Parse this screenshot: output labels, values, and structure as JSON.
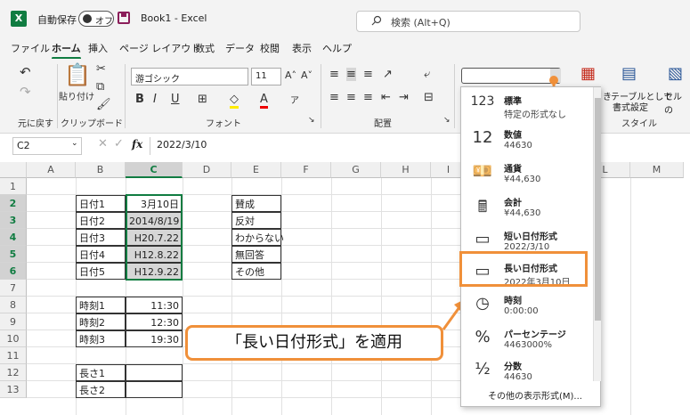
{
  "titlebar": {
    "app_logo": "X",
    "autosave_label": "自動保存",
    "autosave_state": "オフ",
    "book_title": "Book1 - Excel",
    "search_placeholder": "検索 (Alt+Q)"
  },
  "menu": {
    "tabs": [
      "ファイル",
      "ホーム",
      "挿入",
      "ページ レイアウト",
      "数式",
      "データ",
      "校閲",
      "表示",
      "ヘルプ"
    ],
    "active": "ホーム"
  },
  "ribbon": {
    "undo_group": "元に戻す",
    "clipboard_group": "クリップボード",
    "paste_label": "貼り付け",
    "font_group": "フォント",
    "font_name": "游ゴシック",
    "font_size": "11",
    "alignment_group": "配置",
    "styles_group": "スタイル",
    "table_format_label": "テーブルとして",
    "table_format_label2": "書式設定",
    "cell_style_label": "セルの",
    "conditional_label": "き"
  },
  "formula_bar": {
    "name_box": "C2",
    "fx": "fx",
    "value": "2022/3/10"
  },
  "grid": {
    "columns": [
      "A",
      "B",
      "C",
      "D",
      "E",
      "F",
      "G",
      "H",
      "I",
      "J",
      "K",
      "L",
      "M"
    ],
    "selected_column": "C",
    "rows": [
      "1",
      "2",
      "3",
      "4",
      "5",
      "6",
      "7",
      "8",
      "9",
      "10",
      "11",
      "12",
      "13"
    ],
    "b_cells": {
      "2": "日付1",
      "3": "日付2",
      "4": "日付3",
      "5": "日付4",
      "6": "日付5",
      "8": "時刻1",
      "9": "時刻2",
      "10": "時刻3",
      "12": "長さ1",
      "13": "長さ2"
    },
    "c_cells": {
      "2": "3月10日",
      "3": "2014/8/19",
      "4": "H20.7.22",
      "5": "H12.8.22",
      "6": "H12.9.22",
      "8": "11:30",
      "9": "12:30",
      "10": "19:30"
    },
    "e_cells": {
      "2": "賛成",
      "3": "反対",
      "4": "わからない",
      "5": "無回答",
      "6": "その他"
    }
  },
  "number_format_menu": {
    "items": [
      {
        "icon": "123",
        "name": "標準",
        "sample": "特定の形式なし"
      },
      {
        "icon": "12",
        "name": "数値",
        "sample": "44630"
      },
      {
        "icon": "currency-icon",
        "name": "通貨",
        "sample": "¥44,630"
      },
      {
        "icon": "calculator-icon",
        "name": "会計",
        "sample": " ¥44,630"
      },
      {
        "icon": "calendar-icon",
        "name": "短い日付形式",
        "sample": "2022/3/10"
      },
      {
        "icon": "calendar-icon",
        "name": "長い日付形式",
        "sample": "2022年3月10日"
      },
      {
        "icon": "clock-icon",
        "name": "時刻",
        "sample": "0:00:00"
      },
      {
        "icon": "%",
        "name": "パーセンテージ",
        "sample": "4463000%"
      },
      {
        "icon": "½",
        "name": "分数",
        "sample": "44630"
      }
    ],
    "more": "その他の表示形式(M)..."
  },
  "callout": "「長い日付形式」を適用",
  "colors": {
    "excel_green": "#107c41",
    "accent_orange": "#f0903a"
  }
}
